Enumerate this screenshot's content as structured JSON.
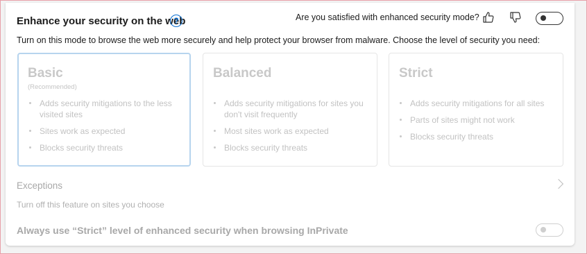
{
  "header": {
    "title": "Enhance your security on the web",
    "help_icon": "question-circle-icon",
    "feedback_question": "Are you satisfied with enhanced security mode?",
    "thumbs_up_icon": "thumbs-up-icon",
    "thumbs_down_icon": "thumbs-down-icon",
    "toggle_state": "off"
  },
  "description": "Turn on this mode to browse the web more securely and help protect your browser from malware. Choose the level of security you need:",
  "levels": [
    {
      "name": "Basic",
      "subtitle": "(Recommended)",
      "selected": true,
      "bullets": [
        "Adds security mitigations to the less visited sites",
        "Sites work as expected",
        "Blocks security threats"
      ]
    },
    {
      "name": "Balanced",
      "selected": false,
      "bullets": [
        "Adds security mitigations for sites you don't visit frequently",
        "Most sites work as expected",
        "Blocks security threats"
      ]
    },
    {
      "name": "Strict",
      "selected": false,
      "bullets": [
        "Adds security mitigations for all sites",
        "Parts of sites might not work",
        "Blocks security threats"
      ]
    }
  ],
  "exceptions": {
    "title": "Exceptions",
    "description": "Turn off this feature on sites you choose"
  },
  "inprivate": {
    "label": "Always use “Strict” level of enhanced security when browsing InPrivate",
    "toggle_state": "off-disabled"
  },
  "colors": {
    "accent": "#0a6ed1",
    "selected_border": "#b6d4ee",
    "disabled_text": "#c2c2c2"
  }
}
